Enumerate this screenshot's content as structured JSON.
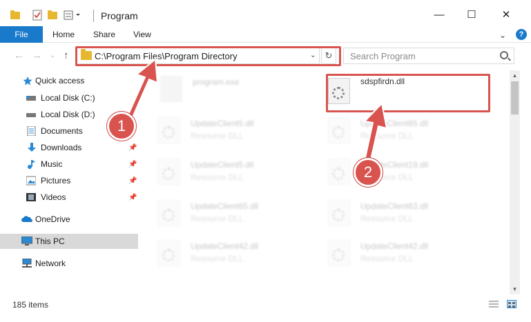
{
  "window": {
    "title": "Program",
    "minimize_glyph": "—",
    "maximize_glyph": "☐",
    "close_glyph": "✕"
  },
  "ribbon": {
    "file_tab": "File",
    "tabs": [
      "Home",
      "Share",
      "View"
    ],
    "help_glyph": "?"
  },
  "nav": {
    "address_path": "C:\\Program Files\\Program Directory",
    "search_placeholder": "Search Program"
  },
  "sidebar": {
    "items": [
      {
        "label": "Quick access",
        "icon": "star-icon"
      },
      {
        "label": "Local Disk (C:)",
        "icon": "drive-icon"
      },
      {
        "label": "Local Disk (D:)",
        "icon": "drive-icon"
      },
      {
        "label": "Documents",
        "icon": "documents-icon"
      },
      {
        "label": "Downloads",
        "icon": "download-icon"
      },
      {
        "label": "Music",
        "icon": "music-icon"
      },
      {
        "label": "Pictures",
        "icon": "pictures-icon"
      },
      {
        "label": "Videos",
        "icon": "videos-icon"
      },
      {
        "label": "OneDrive",
        "icon": "cloud-icon"
      },
      {
        "label": "This PC",
        "icon": "computer-icon"
      },
      {
        "label": "Network",
        "icon": "network-icon"
      }
    ]
  },
  "files": {
    "highlighted": {
      "name": "sdspfirdn.dll"
    },
    "program": {
      "name": "program.exe"
    },
    "left_column": [
      {
        "name": "UpdateClient5.dll",
        "type": "Resource DLL"
      },
      {
        "name": "UpdateClient5.dll",
        "type": "Resource DLL"
      },
      {
        "name": "UpdateClient65.dll",
        "type": "Resource DLL"
      },
      {
        "name": "UpdateClient42.dll",
        "type": "Resource DLL"
      }
    ],
    "right_column": [
      {
        "name": "UpdateClient65.dll",
        "type": "Resource DLL"
      },
      {
        "name": "UpdateClient19.dll",
        "type": "Resource DLL"
      },
      {
        "name": "UpdateClient63.dll",
        "type": "Resource DLL"
      },
      {
        "name": "UpdateClient42.dll",
        "type": "Resource DLL"
      }
    ]
  },
  "status": {
    "item_count": "185 items"
  },
  "annotations": {
    "step1": "1",
    "step2": "2",
    "color": "#d9534f"
  }
}
